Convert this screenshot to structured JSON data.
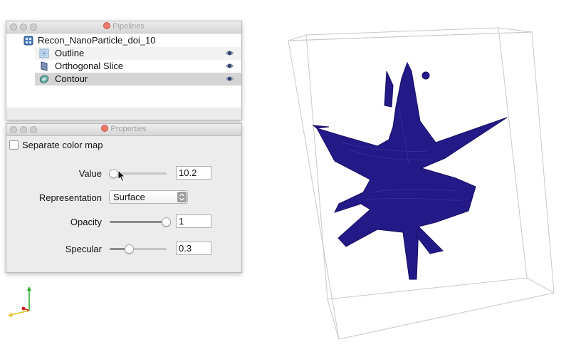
{
  "pipelines": {
    "title": "Pipelines",
    "root": {
      "label": "Recon_NanoParticle_doi_10",
      "icon": "dataset-icon"
    },
    "items": [
      {
        "label": "Outline",
        "icon": "outline-icon",
        "visible": true,
        "selected": false
      },
      {
        "label": "Orthogonal Slice",
        "icon": "slice-icon",
        "visible": true,
        "selected": false
      },
      {
        "label": "Contour",
        "icon": "contour-icon",
        "visible": true,
        "selected": true
      }
    ]
  },
  "properties": {
    "title": "Properties",
    "separate_color_map": {
      "label": "Separate color map",
      "checked": false
    },
    "value": {
      "label": "Value",
      "value": "10.2",
      "slider_fraction": 0.03
    },
    "representation": {
      "label": "Representation",
      "selected": "Surface"
    },
    "opacity": {
      "label": "Opacity",
      "value": "1",
      "slider_fraction": 1.0
    },
    "specular": {
      "label": "Specular",
      "value": "0.3",
      "slider_fraction": 0.3
    }
  },
  "colors": {
    "contour_surface": "#231a87",
    "selection_row": "#d5d5d5",
    "bounding_box": "#c8c8c8"
  },
  "axes_widget": {
    "icon": "orientation-axes-icon"
  }
}
